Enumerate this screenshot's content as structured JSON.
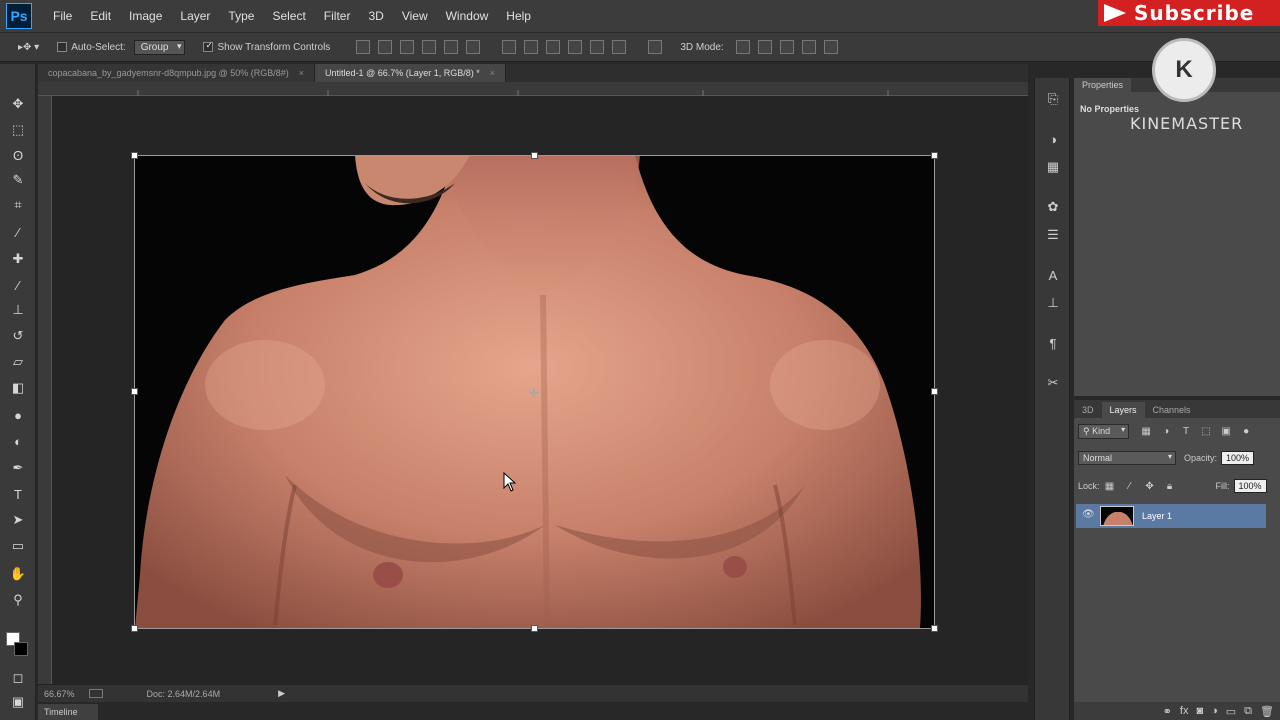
{
  "app": {
    "logo": "Ps"
  },
  "menu": [
    "File",
    "Edit",
    "Image",
    "Layer",
    "Type",
    "Select",
    "Filter",
    "3D",
    "View",
    "Window",
    "Help"
  ],
  "overlay": {
    "subscribe": "Subscribe",
    "kinemaster_logo": "K",
    "kinemaster_text": "KINEMASTER"
  },
  "options_bar": {
    "auto_select_label": "Auto-Select:",
    "auto_select_value": "Group",
    "show_transform_label": "Show Transform Controls",
    "mode_3d_label": "3D Mode:"
  },
  "tabs": [
    {
      "label": "copacabana_by_gadyemsnr-d8qmpub.jpg @ 50% (RGB/8#)",
      "active": false
    },
    {
      "label": "Untitled-1 @ 66.7% (Layer 1, RGB/8) *",
      "active": true
    }
  ],
  "status": {
    "zoom": "66.67%",
    "doc": "Doc: 2.64M/2.64M",
    "timeline": "Timeline"
  },
  "properties": {
    "tab": "Properties",
    "empty_text": "No Properties"
  },
  "layers_panel": {
    "tabs": [
      "3D",
      "Layers",
      "Channels"
    ],
    "filter_kind": "Kind",
    "blend_mode": "Normal",
    "opacity_label": "Opacity:",
    "opacity_value": "100%",
    "lock_label": "Lock:",
    "fill_label": "Fill:",
    "fill_value": "100%",
    "layers": [
      {
        "name": "Layer 1",
        "visible": true,
        "selected": true
      }
    ]
  },
  "icons": {
    "tools": [
      "move-icon",
      "marquee-icon",
      "lasso-icon",
      "quick-select-icon",
      "crop-icon",
      "eyedropper-icon",
      "healing-brush-icon",
      "brush-icon",
      "clone-stamp-icon",
      "history-brush-icon",
      "eraser-icon",
      "gradient-icon",
      "blur-icon",
      "dodge-icon",
      "pen-icon",
      "type-icon",
      "path-select-icon",
      "shape-icon",
      "hand-icon",
      "zoom-icon"
    ]
  }
}
